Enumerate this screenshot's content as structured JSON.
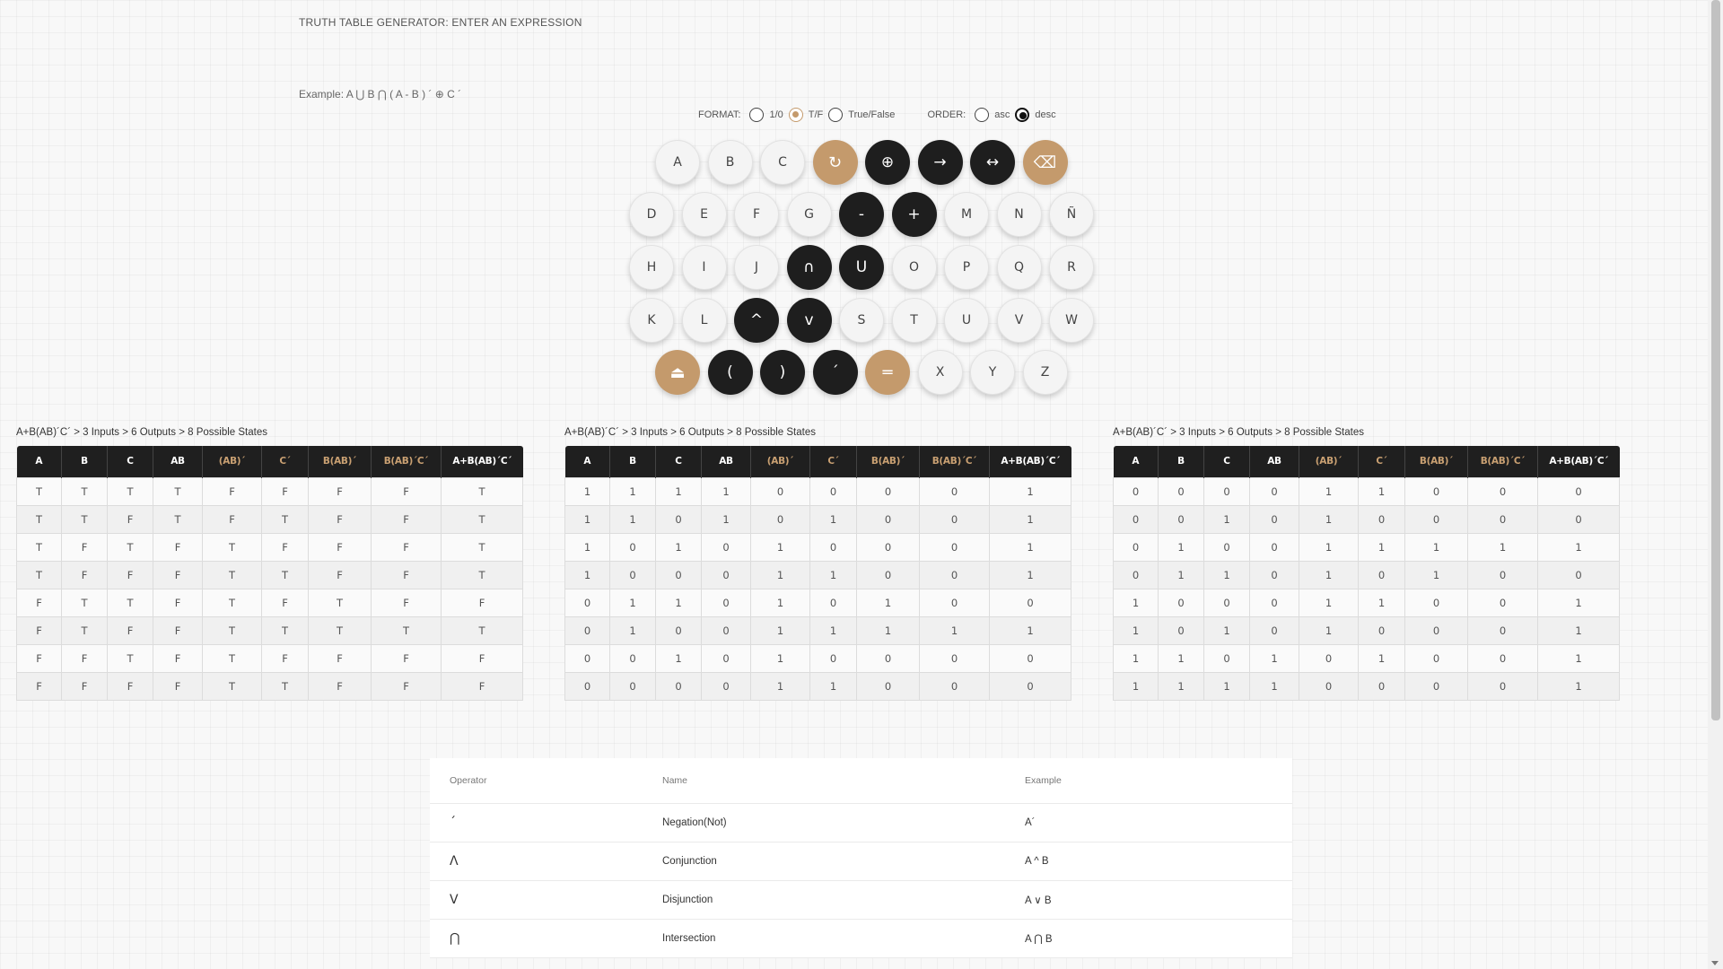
{
  "heading": "TRUTH TABLE GENERATOR: ENTER AN EXPRESSION",
  "example": "Example: A ⋃ B ⋂ ( A - B ) ´ ⊕ C ´",
  "options": {
    "format_label": "FORMAT:",
    "format_choices": [
      "1/0",
      "T/F",
      "True/False"
    ],
    "format_selected": "T/F",
    "order_label": "ORDER:",
    "order_choices": [
      "asc",
      "desc"
    ],
    "order_selected": "desc"
  },
  "keypad": {
    "row1": [
      {
        "label": "A",
        "style": "light",
        "name": "key-a"
      },
      {
        "label": "B",
        "style": "light",
        "name": "key-b"
      },
      {
        "label": "C",
        "style": "light",
        "name": "key-c"
      },
      {
        "label": "↻",
        "style": "tan",
        "name": "reset-icon"
      },
      {
        "label": "⊕",
        "style": "dark",
        "name": "key-xor"
      },
      {
        "label": "→",
        "style": "dark",
        "name": "key-implication"
      },
      {
        "label": "↔",
        "style": "dark",
        "name": "key-biconditional"
      },
      {
        "label": "⌫",
        "style": "tan",
        "name": "backspace-icon"
      }
    ],
    "row2": [
      {
        "label": "D",
        "style": "light",
        "name": "key-d"
      },
      {
        "label": "E",
        "style": "light",
        "name": "key-e"
      },
      {
        "label": "F",
        "style": "light",
        "name": "key-f"
      },
      {
        "label": "G",
        "style": "light",
        "name": "key-g"
      },
      {
        "label": "-",
        "style": "dark",
        "name": "key-difference"
      },
      {
        "label": "+",
        "style": "dark",
        "name": "key-plus"
      },
      {
        "label": "M",
        "style": "light",
        "name": "key-m"
      },
      {
        "label": "N",
        "style": "light",
        "name": "key-n"
      },
      {
        "label": "Ñ",
        "style": "light",
        "name": "key-enye"
      }
    ],
    "row3": [
      {
        "label": "H",
        "style": "light",
        "name": "key-h"
      },
      {
        "label": "I",
        "style": "light",
        "name": "key-i"
      },
      {
        "label": "J",
        "style": "light",
        "name": "key-j"
      },
      {
        "label": "∩",
        "style": "dark",
        "name": "key-intersection"
      },
      {
        "label": "U",
        "style": "dark",
        "name": "key-union"
      },
      {
        "label": "O",
        "style": "light",
        "name": "key-o"
      },
      {
        "label": "P",
        "style": "light",
        "name": "key-p"
      },
      {
        "label": "Q",
        "style": "light",
        "name": "key-q"
      },
      {
        "label": "R",
        "style": "light",
        "name": "key-r"
      }
    ],
    "row4": [
      {
        "label": "K",
        "style": "light",
        "name": "key-k"
      },
      {
        "label": "L",
        "style": "light",
        "name": "key-l"
      },
      {
        "label": "^",
        "style": "dark",
        "name": "key-conjunction"
      },
      {
        "label": "v",
        "style": "dark",
        "name": "key-disjunction"
      },
      {
        "label": "S",
        "style": "light",
        "name": "key-s"
      },
      {
        "label": "T",
        "style": "light",
        "name": "key-t"
      },
      {
        "label": "U",
        "style": "light",
        "name": "key-u"
      },
      {
        "label": "V",
        "style": "light",
        "name": "key-v"
      },
      {
        "label": "W",
        "style": "light",
        "name": "key-w"
      }
    ],
    "row5": [
      {
        "label": "⏏",
        "style": "tan",
        "name": "eject-icon"
      },
      {
        "label": "(",
        "style": "dark",
        "name": "key-open-paren"
      },
      {
        "label": ")",
        "style": "dark",
        "name": "key-close-paren"
      },
      {
        "label": "´",
        "style": "dark",
        "name": "key-negation"
      },
      {
        "label": "═",
        "style": "tan",
        "name": "equals-icon"
      },
      {
        "label": "X",
        "style": "light",
        "name": "key-x"
      },
      {
        "label": "Y",
        "style": "light",
        "name": "key-y"
      },
      {
        "label": "Z",
        "style": "light",
        "name": "key-z"
      }
    ]
  },
  "tables": [
    {
      "caption": "A+B(AB)´C´ > 3 Inputs > 6 Outputs > 8 Possible States",
      "headers": [
        "A",
        "B",
        "C",
        "AB",
        "(AB)´",
        "C´",
        "B(AB)´",
        "B(AB)´C´",
        "A+B(AB)´C´"
      ],
      "rows": [
        [
          "T",
          "T",
          "T",
          "T",
          "F",
          "F",
          "F",
          "F",
          "T"
        ],
        [
          "T",
          "T",
          "F",
          "T",
          "F",
          "T",
          "F",
          "F",
          "T"
        ],
        [
          "T",
          "F",
          "T",
          "F",
          "T",
          "F",
          "F",
          "F",
          "T"
        ],
        [
          "T",
          "F",
          "F",
          "F",
          "T",
          "T",
          "F",
          "F",
          "T"
        ],
        [
          "F",
          "T",
          "T",
          "F",
          "T",
          "F",
          "T",
          "F",
          "F"
        ],
        [
          "F",
          "T",
          "F",
          "F",
          "T",
          "T",
          "T",
          "T",
          "T"
        ],
        [
          "F",
          "F",
          "T",
          "F",
          "T",
          "F",
          "F",
          "F",
          "F"
        ],
        [
          "F",
          "F",
          "F",
          "F",
          "T",
          "T",
          "F",
          "F",
          "F"
        ]
      ]
    },
    {
      "caption": "A+B(AB)´C´ > 3 Inputs > 6 Outputs > 8 Possible States",
      "headers": [
        "A",
        "B",
        "C",
        "AB",
        "(AB)´",
        "C´",
        "B(AB)´",
        "B(AB)´C´",
        "A+B(AB)´C´"
      ],
      "rows": [
        [
          "1",
          "1",
          "1",
          "1",
          "0",
          "0",
          "0",
          "0",
          "1"
        ],
        [
          "1",
          "1",
          "0",
          "1",
          "0",
          "1",
          "0",
          "0",
          "1"
        ],
        [
          "1",
          "0",
          "1",
          "0",
          "1",
          "0",
          "0",
          "0",
          "1"
        ],
        [
          "1",
          "0",
          "0",
          "0",
          "1",
          "1",
          "0",
          "0",
          "1"
        ],
        [
          "0",
          "1",
          "1",
          "0",
          "1",
          "0",
          "1",
          "0",
          "0"
        ],
        [
          "0",
          "1",
          "0",
          "0",
          "1",
          "1",
          "1",
          "1",
          "1"
        ],
        [
          "0",
          "0",
          "1",
          "0",
          "1",
          "0",
          "0",
          "0",
          "0"
        ],
        [
          "0",
          "0",
          "0",
          "0",
          "1",
          "1",
          "0",
          "0",
          "0"
        ]
      ]
    },
    {
      "caption": "A+B(AB)´C´ > 3 Inputs > 6 Outputs > 8 Possible States",
      "headers": [
        "A",
        "B",
        "C",
        "AB",
        "(AB)´",
        "C´",
        "B(AB)´",
        "B(AB)´C´",
        "A+B(AB)´C´"
      ],
      "rows": [
        [
          "0",
          "0",
          "0",
          "0",
          "1",
          "1",
          "0",
          "0",
          "0"
        ],
        [
          "0",
          "0",
          "1",
          "0",
          "1",
          "0",
          "0",
          "0",
          "0"
        ],
        [
          "0",
          "1",
          "0",
          "0",
          "1",
          "1",
          "1",
          "1",
          "1"
        ],
        [
          "0",
          "1",
          "1",
          "0",
          "1",
          "0",
          "1",
          "0",
          "0"
        ],
        [
          "1",
          "0",
          "0",
          "0",
          "1",
          "1",
          "0",
          "0",
          "1"
        ],
        [
          "1",
          "0",
          "1",
          "0",
          "1",
          "0",
          "0",
          "0",
          "1"
        ],
        [
          "1",
          "1",
          "0",
          "1",
          "0",
          "1",
          "0",
          "0",
          "1"
        ],
        [
          "1",
          "1",
          "1",
          "1",
          "0",
          "0",
          "0",
          "0",
          "1"
        ]
      ]
    }
  ],
  "operators": {
    "headers": [
      "Operator",
      "Name",
      "Example"
    ],
    "rows": [
      {
        "symbol": "´",
        "name": "Negation(Not)",
        "example": "A´"
      },
      {
        "symbol": "Λ",
        "name": "Conjunction",
        "example": "A ^ B"
      },
      {
        "symbol": "V",
        "name": "Disjunction",
        "example": "A ∨ B"
      },
      {
        "symbol": "⋂",
        "name": "Intersection",
        "example": "A ⋂ B"
      }
    ]
  },
  "colors": {
    "accent": "#c49a6c",
    "dark": "#1e1e1e"
  }
}
